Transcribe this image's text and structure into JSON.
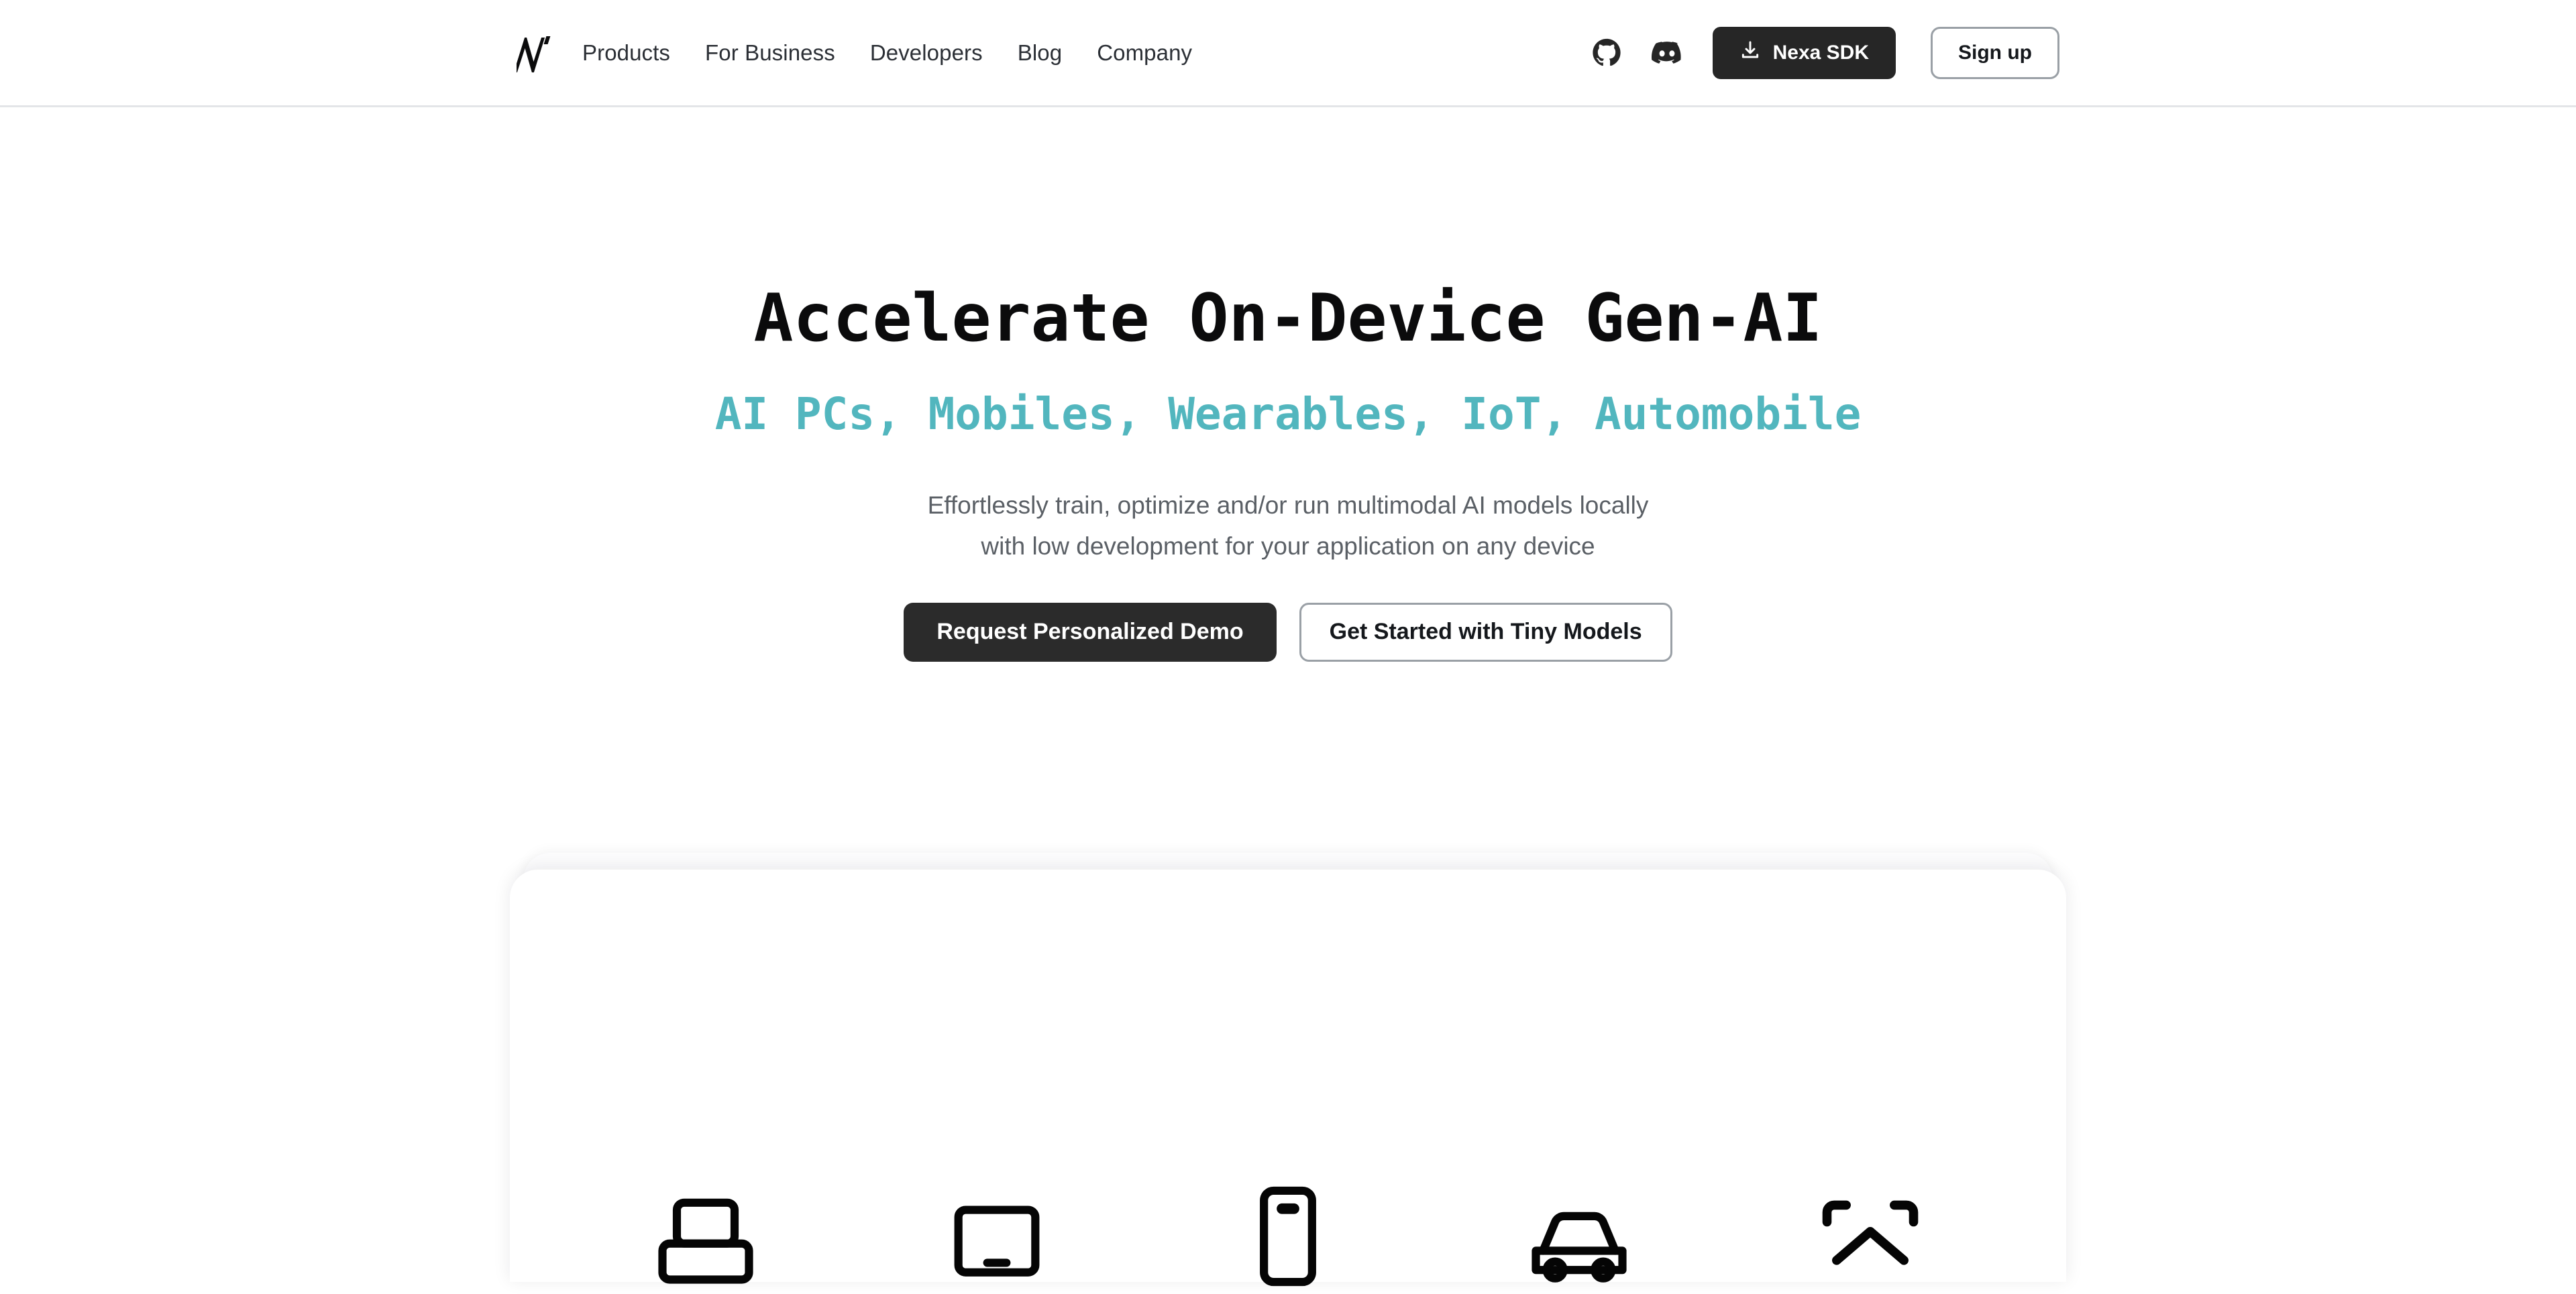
{
  "header": {
    "logo_alt": "Nexa logo",
    "nav": [
      {
        "label": "Products"
      },
      {
        "label": "For Business"
      },
      {
        "label": "Developers"
      },
      {
        "label": "Blog"
      },
      {
        "label": "Company"
      }
    ],
    "social": [
      {
        "name": "github-icon"
      },
      {
        "name": "discord-icon"
      }
    ],
    "sdk_button": {
      "label": "Nexa SDK",
      "icon": "download-icon",
      "background": "#262626",
      "text_color": "#ffffff"
    },
    "signup_button": {
      "label": "Sign up",
      "border_color": "#9aa0a6",
      "text_color": "#15181c"
    },
    "border_bottom_color": "#e3e5e8"
  },
  "hero": {
    "title": "Accelerate On-Device Gen-AI",
    "subtitle": "AI PCs, Mobiles, Wearables, IoT, Automobile",
    "subtitle_color": "#52b6be",
    "description_line_1": "Effortlessly train, optimize and/or run multimodal AI models locally",
    "description_line_2": "with low development for your application on any device",
    "description_color": "#5b6066",
    "primary_cta": {
      "label": "Request Personalized Demo",
      "background": "#2b2b2b",
      "text_color": "#ffffff"
    },
    "secondary_cta": {
      "label": "Get Started with Tiny Models",
      "border_color": "#9aa0a6",
      "text_color": "#15181c"
    }
  },
  "showcase": {
    "card_background": "#ffffff",
    "card_back_background": "#fcfcfd",
    "devices": [
      {
        "name": "laptop-icon"
      },
      {
        "name": "tablet-icon"
      },
      {
        "name": "phone-icon"
      },
      {
        "name": "car-icon"
      },
      {
        "name": "wearable-glasses-icon"
      }
    ]
  }
}
